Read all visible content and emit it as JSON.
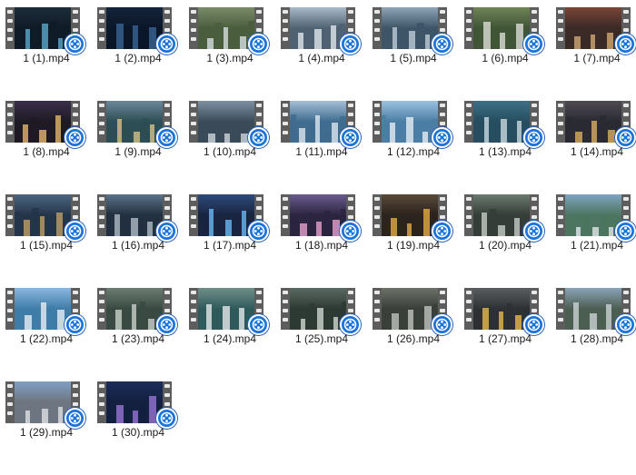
{
  "colors": {
    "badge": "#1a73d9",
    "filmstrip": "#5d5d5d"
  },
  "badge_icon": "video-reel-icon",
  "files": [
    {
      "name": "1 (1).mp4",
      "sky": "#1d2c3a",
      "ground": "#0f1c27",
      "accent": "#5fb1d6"
    },
    {
      "name": "1 (2).mp4",
      "sky": "#14243b",
      "ground": "#0b1628",
      "accent": "#3c6a99"
    },
    {
      "name": "1 (3).mp4",
      "sky": "#7a8b6a",
      "ground": "#4a5e3e",
      "accent": "#dfe7ea"
    },
    {
      "name": "1 (4).mp4",
      "sky": "#a9b9c8",
      "ground": "#4f6272",
      "accent": "#e8eef3"
    },
    {
      "name": "1 (5).mp4",
      "sky": "#8fa4b6",
      "ground": "#3e5568",
      "accent": "#c7d3dd"
    },
    {
      "name": "1 (6).mp4",
      "sky": "#6f8457",
      "ground": "#3f5535",
      "accent": "#e6e6e0"
    },
    {
      "name": "1 (7).mp4",
      "sky": "#7a4538",
      "ground": "#3b2a26",
      "accent": "#d9b07a"
    },
    {
      "name": "1 (8).mp4",
      "sky": "#3a2f4a",
      "ground": "#1e1a24",
      "accent": "#f0c070"
    },
    {
      "name": "1 (9).mp4",
      "sky": "#6b8899",
      "ground": "#2e4e55",
      "accent": "#e0c98a"
    },
    {
      "name": "1 (10).mp4",
      "sky": "#7e91a3",
      "ground": "#3a4a59",
      "accent": "#d8e0e7"
    },
    {
      "name": "1 (11).mp4",
      "sky": "#a7bfd6",
      "ground": "#3f6c8f",
      "accent": "#e7eff5"
    },
    {
      "name": "1 (12).mp4",
      "sky": "#9cc0df",
      "ground": "#4a7ea4",
      "accent": "#f2f4f6"
    },
    {
      "name": "1 (13).mp4",
      "sky": "#3e6f86",
      "ground": "#274e60",
      "accent": "#d6e3ea"
    },
    {
      "name": "1 (14).mp4",
      "sky": "#4f4a52",
      "ground": "#2a2a32",
      "accent": "#e6b664"
    },
    {
      "name": "1 (15).mp4",
      "sky": "#4d6580",
      "ground": "#24354a",
      "accent": "#c7a66a"
    },
    {
      "name": "1 (16).mp4",
      "sky": "#5b7388",
      "ground": "#223040",
      "accent": "#b8c4cf"
    },
    {
      "name": "1 (17).mp4",
      "sky": "#2d4b7a",
      "ground": "#1a2540",
      "accent": "#6fc3ff"
    },
    {
      "name": "1 (18).mp4",
      "sky": "#6a5b8e",
      "ground": "#2b2540",
      "accent": "#f1a9d6"
    },
    {
      "name": "1 (19).mp4",
      "sky": "#5a4a3a",
      "ground": "#2b231d",
      "accent": "#f0b44a"
    },
    {
      "name": "1 (20).mp4",
      "sky": "#6c7a6f",
      "ground": "#343d38",
      "accent": "#cfd6cf"
    },
    {
      "name": "1 (21).mp4",
      "sky": "#7fa3c0",
      "ground": "#4d7561",
      "accent": "#e9eef1"
    },
    {
      "name": "1 (22).mp4",
      "sky": "#8ab7e0",
      "ground": "#3f7da8",
      "accent": "#f3f6f8"
    },
    {
      "name": "1 (23).mp4",
      "sky": "#6a7d70",
      "ground": "#3a4a42",
      "accent": "#d3d9d2"
    },
    {
      "name": "1 (24).mp4",
      "sky": "#6f8f88",
      "ground": "#2f5a5b",
      "accent": "#f0f2f2"
    },
    {
      "name": "1 (25).mp4",
      "sky": "#5b6a62",
      "ground": "#2d3a33",
      "accent": "#d8e0da"
    },
    {
      "name": "1 (26).mp4",
      "sky": "#6b7268",
      "ground": "#3a3f3a",
      "accent": "#c8ccc6"
    },
    {
      "name": "1 (27).mp4",
      "sky": "#5a5e60",
      "ground": "#2e3133",
      "accent": "#f2c14e"
    },
    {
      "name": "1 (28).mp4",
      "sky": "#8aa4b8",
      "ground": "#4c5d52",
      "accent": "#d3d9dc"
    },
    {
      "name": "1 (29).mp4",
      "sky": "#7f9fc4",
      "ground": "#6d7580",
      "accent": "#e6e8ea"
    },
    {
      "name": "1 (30).mp4",
      "sky": "#1c2d5a",
      "ground": "#132040",
      "accent": "#a07ae0"
    }
  ]
}
